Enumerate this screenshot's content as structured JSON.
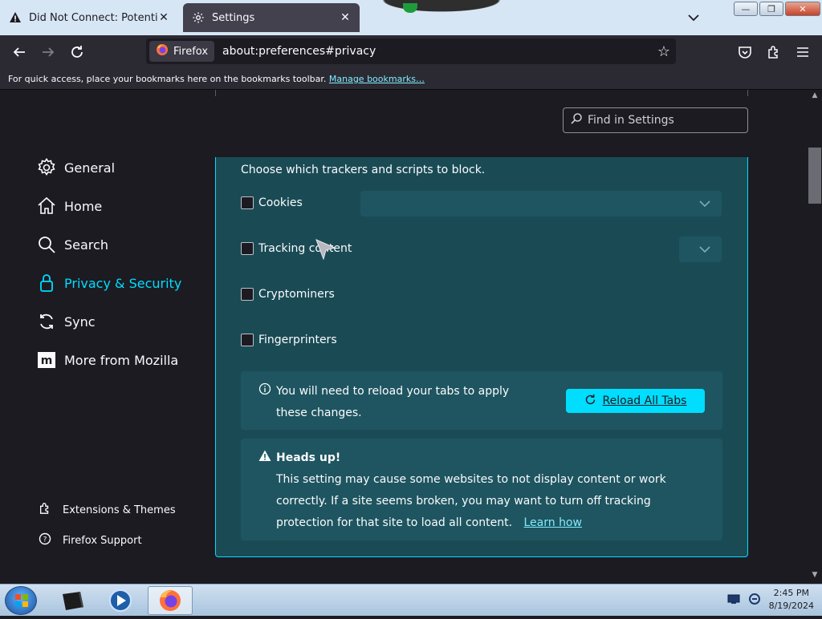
{
  "tabs": [
    {
      "title": "Did Not Connect: Potential Security Issue",
      "icon": "warning-icon",
      "close": "✕"
    },
    {
      "title": "Settings",
      "icon": "gear-icon",
      "close": "✕"
    }
  ],
  "window_controls": {
    "minimize": "—",
    "maximize": "❐",
    "close": "✕"
  },
  "nav": {
    "identity_label": "Firefox",
    "url": "about:preferences#privacy"
  },
  "bookmarks_bar": {
    "message": "For quick access, place your bookmarks here on the bookmarks toolbar.",
    "link": "Manage bookmarks…"
  },
  "settings_search": {
    "placeholder": "Find in Settings"
  },
  "categories": [
    {
      "label": "General",
      "icon": "gear-icon"
    },
    {
      "label": "Home",
      "icon": "home-icon"
    },
    {
      "label": "Search",
      "icon": "search-icon"
    },
    {
      "label": "Privacy & Security",
      "icon": "lock-icon",
      "selected": true
    },
    {
      "label": "Sync",
      "icon": "sync-icon"
    },
    {
      "label": "More from Mozilla",
      "icon": "mozilla-icon"
    }
  ],
  "footer_links": [
    {
      "label": "Extensions & Themes",
      "icon": "puzzle-icon"
    },
    {
      "label": "Firefox Support",
      "icon": "help-icon"
    }
  ],
  "custom_panel": {
    "intro": "Choose which trackers and scripts to block.",
    "checkboxes": [
      {
        "label": "Cookies",
        "checked": false
      },
      {
        "label": "Tracking content",
        "checked": false
      },
      {
        "label": "Cryptominers",
        "checked": false
      },
      {
        "label": "Fingerprinters",
        "checked": false
      }
    ],
    "reload_notice": "You will need to reload your tabs to apply these changes.",
    "reload_button": "Reload All Tabs",
    "warning_title": "Heads up!",
    "warning_text": "This setting may cause some websites to not display content or work correctly. If a site seems broken, you may want to turn off tracking protection for that site to load all content.",
    "warning_link": "Learn how"
  },
  "taskbar": {
    "time": "2:45 PM",
    "date": "8/19/2024"
  },
  "colors": {
    "accent": "#00ddff",
    "panel_bg": "#1a4b55",
    "page_bg": "#1c1b22"
  }
}
